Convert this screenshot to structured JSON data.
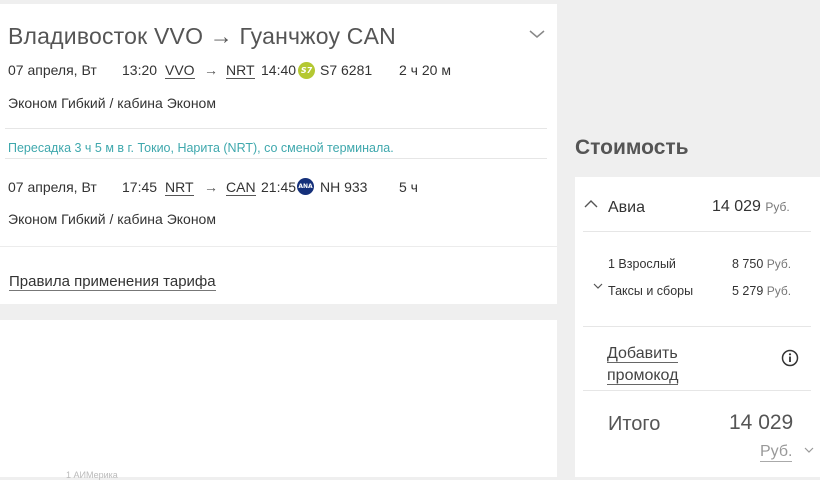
{
  "flight": {
    "title": "Владивосток VVO → Гуанчжоу CAN",
    "segments": [
      {
        "date": "07 апреля, Вт",
        "dep_time": "13:20",
        "dep_code": "VVO",
        "arrow": "→",
        "arr_code": "NRT",
        "arr_time": "14:40",
        "airline_icon": "s7-airlines-logo",
        "airline_logo_text": "S7",
        "flight_no": "S7 6281",
        "duration": "2 ч 20 м",
        "fare": "Эконом Гибкий / кабина Эконом"
      },
      {
        "date": "07 апреля, Вт",
        "dep_time": "17:45",
        "dep_code": "NRT",
        "arrow": "→",
        "arr_code": "CAN",
        "arr_time": "21:45",
        "airline_icon": "ana-logo",
        "airline_logo_text": "ANA",
        "flight_no": "NH 933",
        "duration": "5 ч",
        "fare": "Эконом Гибкий / кабина Эконом"
      }
    ],
    "transfer": "Пересадка 3 ч 5 м в г. Токио, Нарита (NRT), со сменой терминала.",
    "rules_link": "Правила применения тарифа",
    "colors": {
      "transfer_text": "#3fa8ad",
      "s7_logo": "#b4c832",
      "ana_logo": "#15307a"
    }
  },
  "cost": {
    "title": "Стоимость",
    "air": {
      "label": "Авиа",
      "price": "14 029",
      "currency": "Руб.",
      "breakdown": [
        {
          "label": "1 Взрослый",
          "value": "8 750",
          "currency": "Руб."
        },
        {
          "label": "Таксы и сборы",
          "value": "5 279",
          "currency": "Руб."
        }
      ]
    },
    "promo": {
      "line1": "Добавить",
      "line2": "промокод"
    },
    "total": {
      "label": "Итого",
      "value": "14 029",
      "currency": "Руб."
    }
  },
  "footer_faint": "1 АИМерика"
}
